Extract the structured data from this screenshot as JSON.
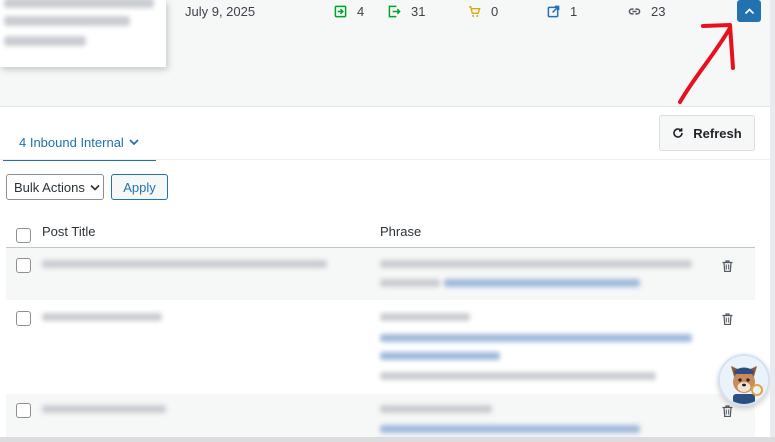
{
  "post_row": {
    "date": "July 9, 2025",
    "stats": [
      {
        "icon": "inbound-internal-icon",
        "value": "4",
        "color": "#00a32a"
      },
      {
        "icon": "outbound-internal-icon",
        "value": "31",
        "color": "#00a32a"
      },
      {
        "icon": "cart-icon",
        "value": "0",
        "color": "#dba617"
      },
      {
        "icon": "external-link-icon",
        "value": "1",
        "color": "#2271b1"
      },
      {
        "icon": "link-icon",
        "value": "23",
        "color": "#50575e"
      }
    ]
  },
  "tab": {
    "label": "4 Inbound Internal"
  },
  "toolbar": {
    "refresh_label": "Refresh",
    "bulk_actions_label": "Bulk Actions",
    "apply_label": "Apply"
  },
  "table": {
    "columns": [
      "Post Title",
      "Phrase"
    ]
  },
  "colors": {
    "accent": "#2271b1",
    "annotation": "#e8101e"
  }
}
